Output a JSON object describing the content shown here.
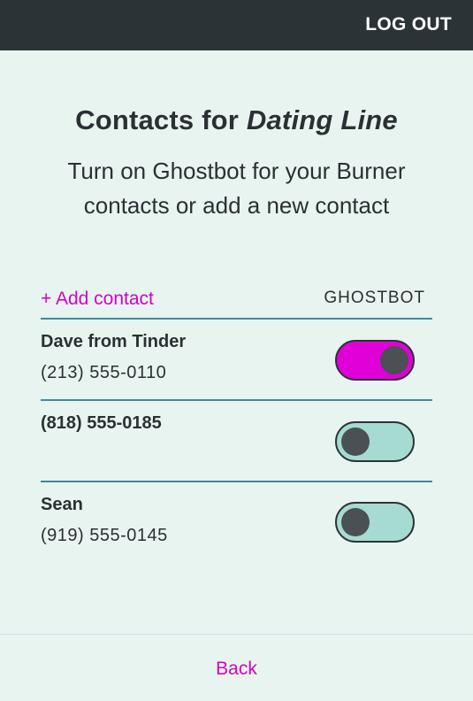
{
  "header": {
    "logout_label": "LOG OUT"
  },
  "title": {
    "prefix": "Contacts for ",
    "line_name": "Dating Line"
  },
  "subtitle": "Turn on Ghostbot for your Burner contacts or add a new contact",
  "list_header": {
    "add_contact": "+ Add contact",
    "ghostbot": "GHOSTBOT"
  },
  "contacts": [
    {
      "name": "Dave from Tinder",
      "phone": "(213) 555-0110",
      "ghostbot_on": true
    },
    {
      "name": "(818) 555-0185",
      "phone": "",
      "ghostbot_on": false
    },
    {
      "name": "Sean",
      "phone": "(919) 555-0145",
      "ghostbot_on": false
    }
  ],
  "colors": {
    "accent": "#d400c8",
    "toggle_on": "#e000d8",
    "toggle_off": "#a6dbd1",
    "topbar": "#2c3336",
    "background": "#e8f4f0"
  },
  "footer": {
    "back_label": "Back"
  }
}
